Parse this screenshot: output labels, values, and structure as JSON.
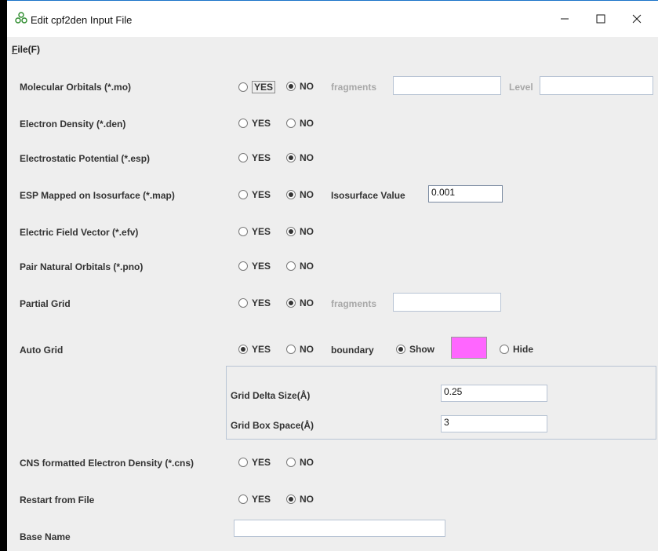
{
  "window": {
    "title": "Edit cpf2den Input File"
  },
  "menu": {
    "file_mnemonic": "F",
    "file_rest": "ile(F)"
  },
  "rows": {
    "mo": {
      "label": "Molecular Orbitals (*.mo)",
      "yes": "YES",
      "no": "NO",
      "selected": "NO",
      "fragments_label": "fragments",
      "fragments_value": "",
      "level_label": "Level",
      "level_value": ""
    },
    "den": {
      "label": "Electron Density (*.den)",
      "yes": "YES",
      "no": "NO",
      "selected": ""
    },
    "esp": {
      "label": "Electrostatic Potential (*.esp)",
      "yes": "YES",
      "no": "NO",
      "selected": "NO"
    },
    "map": {
      "label": "ESP Mapped on Isosurface (*.map)",
      "yes": "YES",
      "no": "NO",
      "selected": "NO",
      "iso_label": "Isosurface Value",
      "iso_value": "0.001"
    },
    "efv": {
      "label": "Electric Field Vector (*.efv)",
      "yes": "YES",
      "no": "NO",
      "selected": "NO"
    },
    "pno": {
      "label": "Pair Natural Orbitals (*.pno)",
      "yes": "YES",
      "no": "NO",
      "selected": ""
    },
    "partial": {
      "label": "Partial Grid",
      "yes": "YES",
      "no": "NO",
      "selected": "NO",
      "fragments_label": "fragments",
      "fragments_value": ""
    },
    "auto": {
      "label": "Auto Grid",
      "yes": "YES",
      "no": "NO",
      "selected": "YES",
      "boundary_label": "boundary",
      "show": "Show",
      "hide": "Hide",
      "boundary_selected": "Show",
      "boundary_color": "#ff66ff"
    },
    "grid": {
      "delta_label": "Grid Delta Size(Å)",
      "delta_value": "0.25",
      "space_label": "Grid Box Space(Å)",
      "space_value": "3"
    },
    "cns": {
      "label": "CNS formatted Electron Density (*.cns)",
      "yes": "YES",
      "no": "NO",
      "selected": ""
    },
    "restart": {
      "label": "Restart from File",
      "yes": "YES",
      "no": "NO",
      "selected": "NO"
    },
    "base": {
      "label": "Base Name",
      "value": ""
    }
  },
  "icons": {
    "app": "molecule-icon",
    "minimize": "minimize-icon",
    "maximize": "maximize-icon",
    "close": "close-icon"
  },
  "colors": {
    "titlebar_border": "#1a73c8",
    "swatch": "#ff66ff",
    "background": "#eeeeee"
  }
}
